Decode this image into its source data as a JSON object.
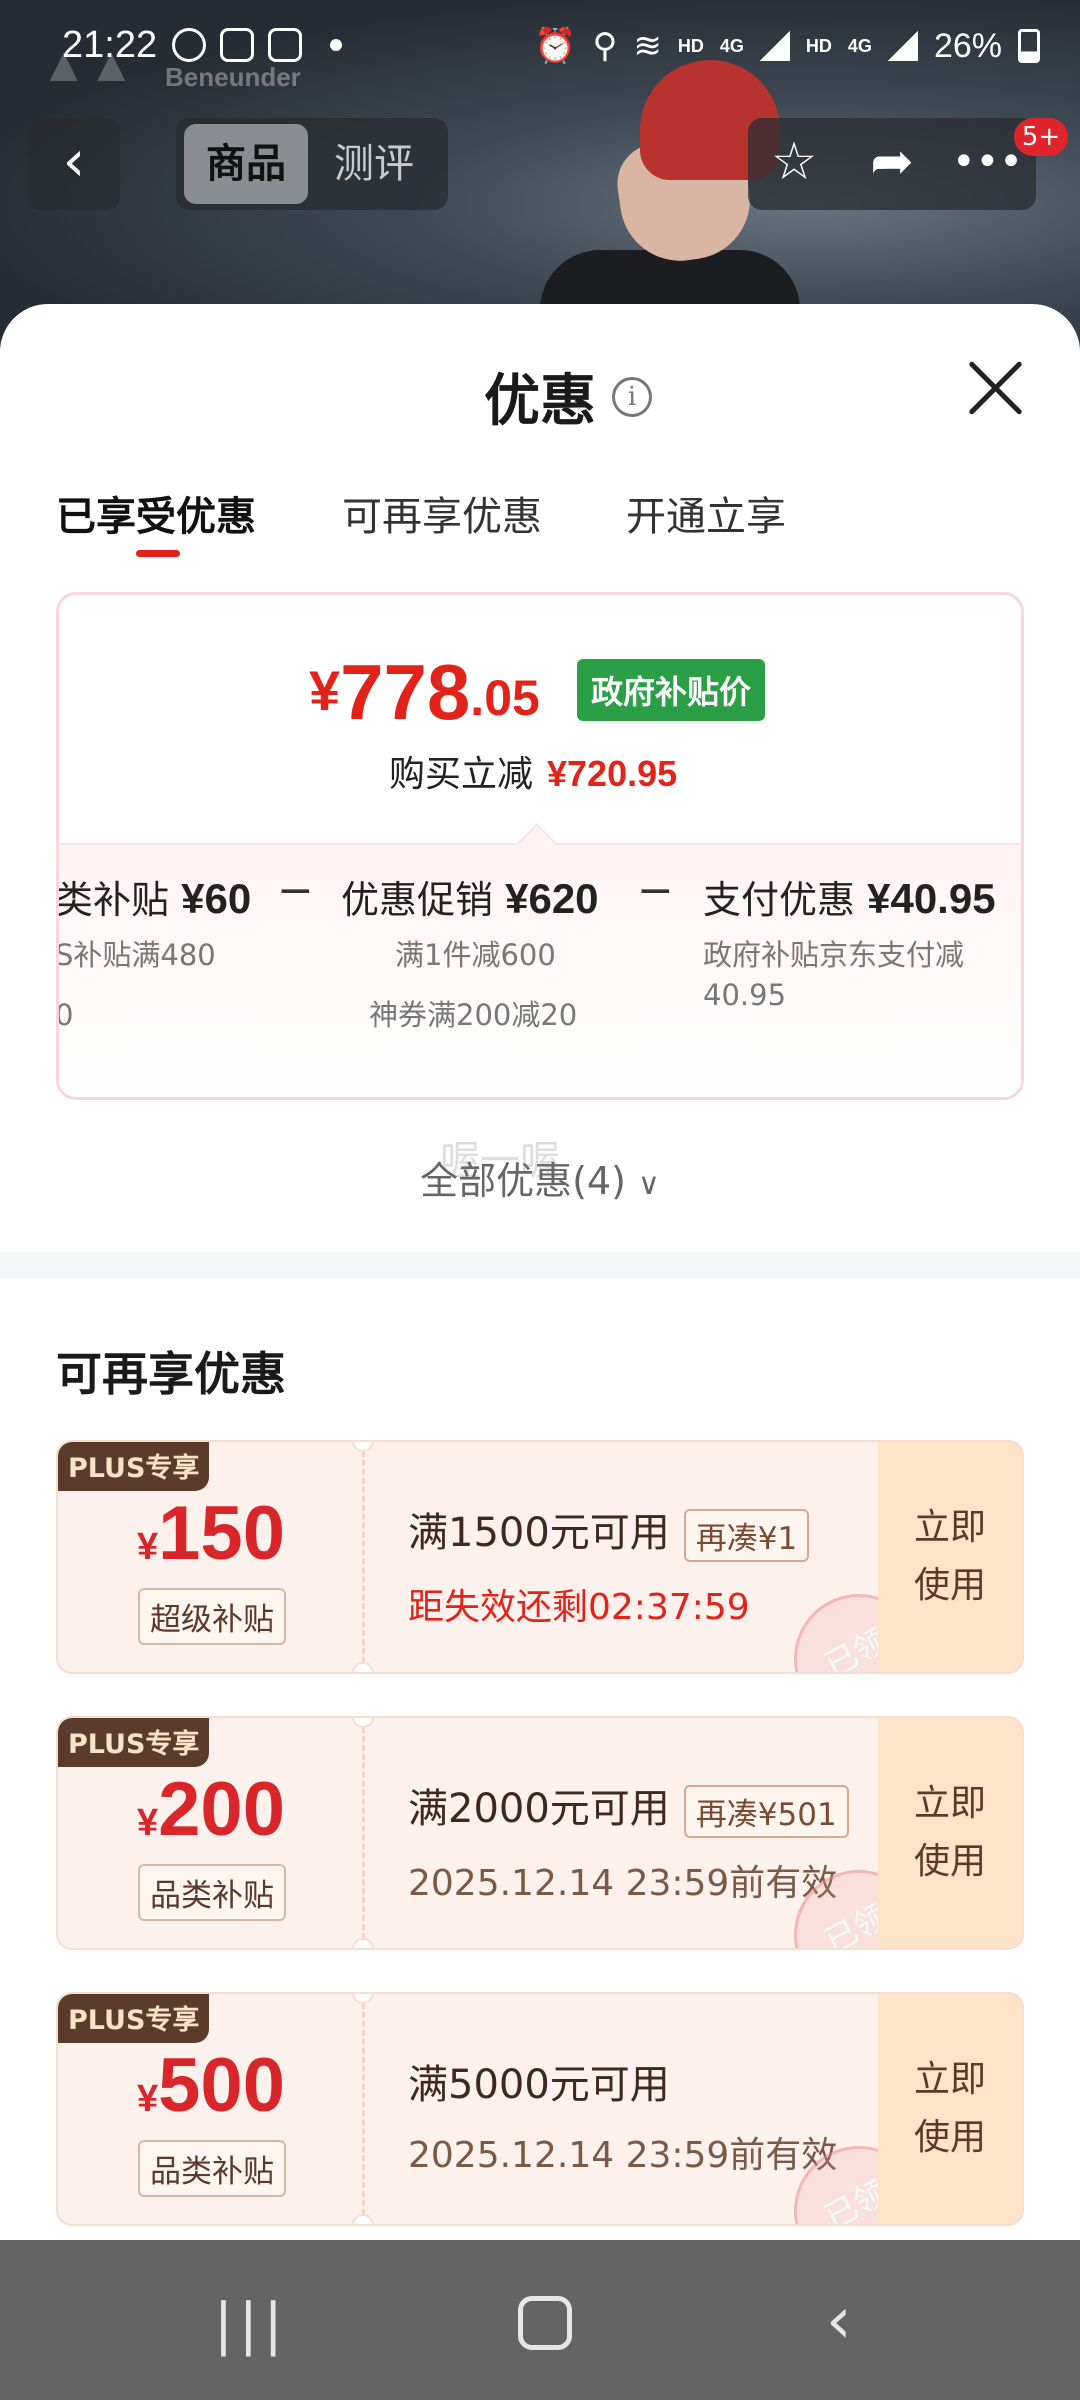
{
  "status_bar": {
    "time": "21:22",
    "hd1": "HD",
    "net1": "4G",
    "hd2": "HD",
    "net2": "4G",
    "battery": "26%"
  },
  "background": {
    "brand": "Beneunder"
  },
  "top_nav": {
    "back": "‹",
    "tab_product": "商品",
    "tab_review": "测评",
    "badge": "5+"
  },
  "sheet": {
    "title": "优惠",
    "info": "i",
    "tabs": [
      "已享受优惠",
      "可再享优惠",
      "开通立享"
    ]
  },
  "price_card": {
    "yen": "¥",
    "price_int": "778",
    "price_dec": ".05",
    "gov_badge": "政府补贴价",
    "reduce_label": "购买立减",
    "reduce_amount": "¥720.95",
    "breakdown": [
      {
        "label": "类补贴",
        "amount": "¥60",
        "sub1": "S补贴满480",
        "sub2": "0"
      },
      {
        "label": "优惠促销",
        "amount": "¥620",
        "sub1": "满1件减600",
        "sub2": "神券满200减20"
      },
      {
        "label": "支付优惠",
        "amount": "¥40.95",
        "sub1": "政府补贴京东支付减",
        "sub2": "40.95"
      }
    ],
    "minus": "−"
  },
  "all_discounts": {
    "label": "全部优惠(4)",
    "ghost": "喔一喔"
  },
  "more_section": {
    "title": "可再享优惠",
    "coupons": [
      {
        "tag": "PLUS专享",
        "yen": "¥",
        "amount": "150",
        "type": "超级补贴",
        "condition": "满1500元可用",
        "extra": "再凑¥1",
        "sub": "距失效还剩02:37:59",
        "action_line1": "立即",
        "action_line2": "使用",
        "stamp": "已领"
      },
      {
        "tag": "PLUS专享",
        "yen": "¥",
        "amount": "200",
        "type": "品类补贴",
        "condition": "满2000元可用",
        "extra": "再凑¥501",
        "sub": "2025.12.14 23:59前有效",
        "action_line1": "立即",
        "action_line2": "使用",
        "stamp": "已领"
      },
      {
        "tag": "PLUS专享",
        "yen": "¥",
        "amount": "500",
        "type": "品类补贴",
        "condition": "满5000元可用",
        "extra": "",
        "sub": "2025.12.14 23:59前有效",
        "action_line1": "立即",
        "action_line2": "使用",
        "stamp": "已领"
      }
    ]
  },
  "colors": {
    "accent_red": "#e2231a",
    "gov_green": "#2a9f46",
    "plus_brown": "#5a3b2c",
    "coupon_bg": "#fcf1ec"
  }
}
